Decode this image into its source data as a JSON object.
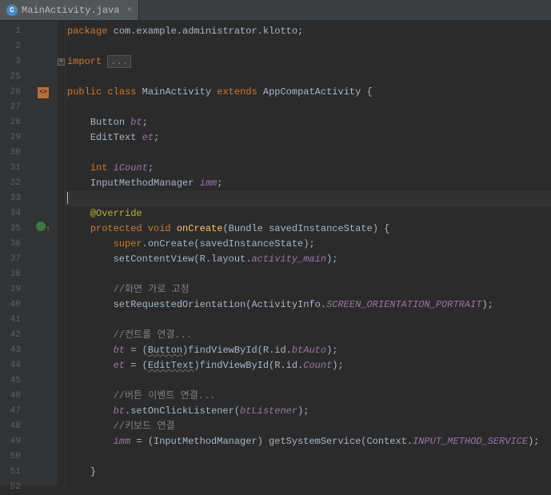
{
  "tab": {
    "label": "MainActivity.java",
    "icon_letter": "C"
  },
  "line_numbers": [
    "1",
    "2",
    "3",
    "25",
    "26",
    "27",
    "28",
    "29",
    "30",
    "31",
    "32",
    "33",
    "34",
    "35",
    "36",
    "37",
    "38",
    "39",
    "40",
    "41",
    "42",
    "43",
    "44",
    "45",
    "46",
    "47",
    "48",
    "49",
    "50",
    "51",
    "52"
  ],
  "code": {
    "l1": {
      "kw": "package",
      "rest": " com.example.administrator.klotto;"
    },
    "l3": {
      "kw": "import ",
      "fold": "..."
    },
    "l26": {
      "pub": "public ",
      "cls": "class ",
      "name": "MainActivity ",
      "ext": "extends ",
      "sup": "AppCompatActivity {"
    },
    "l28": {
      "type": "Button ",
      "var": "bt",
      "semi": ";"
    },
    "l29": {
      "type": "EditText ",
      "var": "et",
      "semi": ";"
    },
    "l31": {
      "type": "int ",
      "var": "iCount",
      "semi": ";"
    },
    "l32": {
      "type": "InputMethodManager ",
      "var": "imm",
      "semi": ";"
    },
    "l34": {
      "ann": "@Override"
    },
    "l35": {
      "prot": "protected ",
      "void": "void ",
      "mth": "onCreate",
      "lp": "(",
      "ptype": "Bundle ",
      "pname": "savedInstanceState) {"
    },
    "l36": {
      "sup": "super",
      "rest1": ".onCreate(savedInstanceState);"
    },
    "l37": {
      "call": "setContentView(R.layout.",
      "res": "activity_main",
      "end": ");"
    },
    "l39": {
      "cmt": "//화면 가로 고정"
    },
    "l40": {
      "call": "setRequestedOrientation(ActivityInfo.",
      "cnst": "SCREEN_ORIENTATION_PORTRAIT",
      "end": ");"
    },
    "l42": {
      "cmt": "//컨트롤 연결..."
    },
    "l43": {
      "var": "bt",
      "eq": " = (",
      "cast": "Button",
      "rest": ")findViewById(R.id.",
      "id": "btAuto",
      "end": ");"
    },
    "l44": {
      "var": "et",
      "eq": " = (",
      "cast": "EditText",
      "rest": ")findViewById(R.id.",
      "id": "Count",
      "end": ");"
    },
    "l46": {
      "cmt": "//버튼 이벤트 연결..."
    },
    "l47": {
      "var": "bt",
      "rest": ".setOnClickListener(",
      "arg": "btListener",
      "end": ");"
    },
    "l48": {
      "cmt": "//키보드 연결"
    },
    "l49": {
      "var": "imm",
      "eq": " = (InputMethodManager) getSystemService(Context.",
      "cnst": "INPUT_METHOD_SERVICE",
      "end": ");"
    },
    "l51": {
      "brace": "}"
    }
  }
}
